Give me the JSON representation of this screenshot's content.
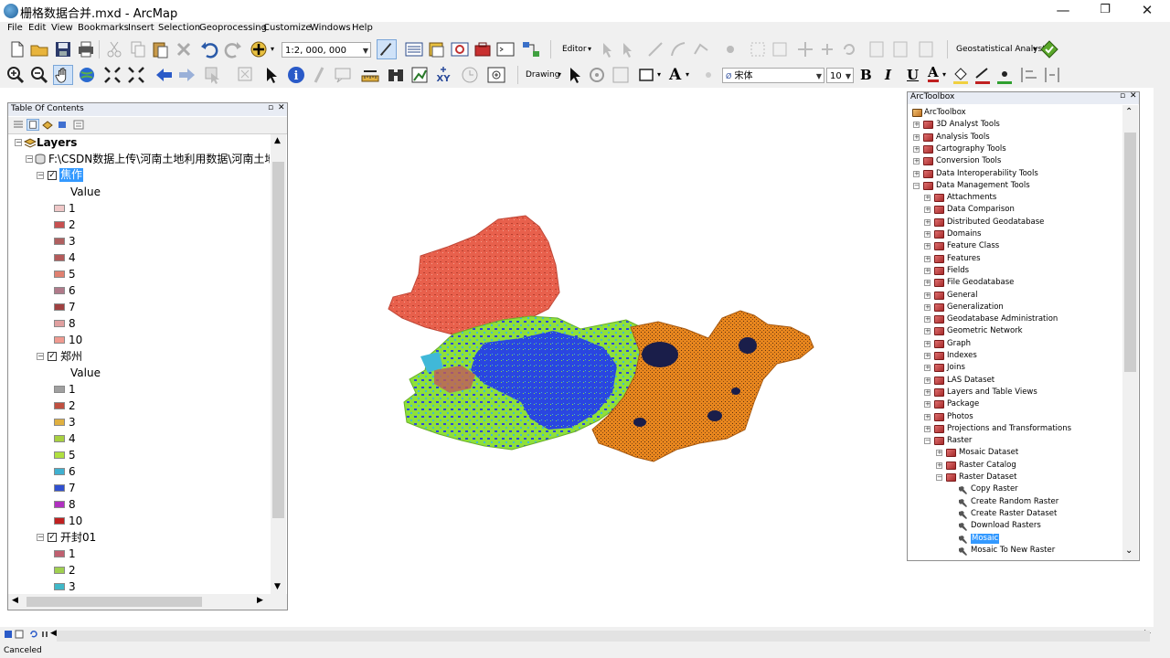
{
  "window": {
    "title": "栅格数据合并.mxd - ArcMap",
    "controls": {
      "minimize": "—",
      "maximize": "❐",
      "close": "✕"
    }
  },
  "menu": [
    "File",
    "Edit",
    "View",
    "Bookmarks",
    "Insert",
    "Selection",
    "Geoprocessing",
    "Customize",
    "Windows",
    "Help"
  ],
  "toolbar": {
    "scale": "1:2, 000, 000",
    "editor_label": "Editor",
    "geostat_label": "Geostatistical Analyst",
    "drawing_label": "Drawing",
    "font_name": "宋体",
    "font_size": "10",
    "bold": "B",
    "italic": "I",
    "underline": "U",
    "font_color_glyph": "A"
  },
  "toc": {
    "title": "Table Of Contents",
    "root": "Layers",
    "source": "F:\\CSDN数据上传\\河南土地利用数据\\河南土地",
    "value_label": "Value",
    "layers": [
      {
        "name": "焦作",
        "selected": true,
        "classes": [
          {
            "label": "1",
            "color": "#f0c8c8"
          },
          {
            "label": "2",
            "color": "#c85050"
          },
          {
            "label": "3",
            "color": "#b06060"
          },
          {
            "label": "4",
            "color": "#b45a5a"
          },
          {
            "label": "5",
            "color": "#e08070"
          },
          {
            "label": "6",
            "color": "#b07a8a"
          },
          {
            "label": "7",
            "color": "#a04040"
          },
          {
            "label": "8",
            "color": "#e0a0a0"
          },
          {
            "label": "10",
            "color": "#f09a90"
          }
        ]
      },
      {
        "name": "郑州",
        "selected": false,
        "classes": [
          {
            "label": "1",
            "color": "#a0a0a0"
          },
          {
            "label": "2",
            "color": "#c05040"
          },
          {
            "label": "3",
            "color": "#e0b040"
          },
          {
            "label": "4",
            "color": "#a8d040"
          },
          {
            "label": "5",
            "color": "#b0e040"
          },
          {
            "label": "6",
            "color": "#40b0d0"
          },
          {
            "label": "7",
            "color": "#3050d0"
          },
          {
            "label": "8",
            "color": "#b030c0"
          },
          {
            "label": "10",
            "color": "#c02020"
          }
        ]
      },
      {
        "name": "开封01",
        "selected": false,
        "classes": [
          {
            "label": "1",
            "color": "#c06070"
          },
          {
            "label": "2",
            "color": "#a0d050"
          },
          {
            "label": "3",
            "color": "#40b8c8"
          }
        ]
      }
    ]
  },
  "arctoolbox": {
    "title": "ArcToolbox",
    "root": "ArcToolbox",
    "toolboxes": [
      "3D Analyst Tools",
      "Analysis Tools",
      "Cartography Tools",
      "Conversion Tools",
      "Data Interoperability Tools",
      "Data Management Tools"
    ],
    "data_management_sets": [
      "Attachments",
      "Data Comparison",
      "Distributed Geodatabase",
      "Domains",
      "Feature Class",
      "Features",
      "Fields",
      "File Geodatabase",
      "General",
      "Generalization",
      "Geodatabase Administration",
      "Geometric Network",
      "Graph",
      "Indexes",
      "Joins",
      "LAS Dataset",
      "Layers and Table Views",
      "Package",
      "Photos",
      "Projections and Transformations",
      "Raster"
    ],
    "raster_sets": [
      "Mosaic Dataset",
      "Raster Catalog",
      "Raster Dataset"
    ],
    "raster_dataset_tools": [
      "Copy Raster",
      "Create Random Raster",
      "Create Raster Dataset",
      "Download Rasters",
      "Mosaic",
      "Mosaic To New Raster"
    ],
    "selected_tool": "Mosaic"
  },
  "status": {
    "text": "Canceled"
  },
  "colors": {
    "jiaozuo_region": "#e8604c",
    "zhengzhou_blue": "#2a46e0",
    "zhengzhou_green": "#8ee03a",
    "kaifeng_orange": "#e8861e",
    "kaifeng_dark": "#1a1e4a",
    "selection": "#3399ff"
  }
}
